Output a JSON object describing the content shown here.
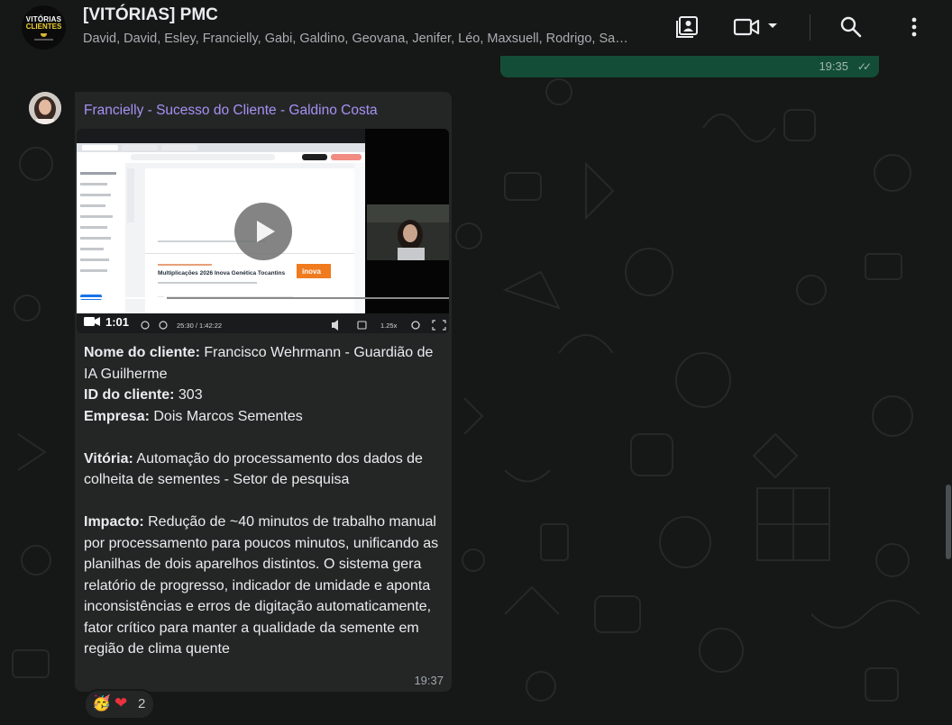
{
  "header": {
    "group_avatar_line1": "VITÓRIAS",
    "group_avatar_line2": "CLIENTES",
    "title": "[VITÓRIAS] PMC",
    "members": "David, David, Esley, Francielly, Gabi, Galdino, Geovana, Jenifer, Léo, Maxsuell, Rodrigo, Sandro, Você"
  },
  "icons": {
    "contact_card": "contact-card-icon",
    "video_call": "video-call-icon",
    "dropdown": "chevron-down-icon",
    "search": "search-icon",
    "menu": "more-vertical-icon"
  },
  "previous_message": {
    "time": "19:35",
    "status": "read"
  },
  "message": {
    "sender": "Francielly - Sucesso do Cliente - Galdino Costa",
    "video": {
      "duration": "1:01",
      "player_time": "25:30 / 1:42:22",
      "player_speed": "1.25x",
      "slide_title": "Multiplicações 2026 Inova Genética Tocantins",
      "slide_logo": "inova"
    },
    "fields": [
      {
        "label": "Nome do cliente:",
        "value": " Francisco Wehrmann - Guardião de IA Guilherme"
      },
      {
        "label": "ID do cliente:",
        "value": " 303"
      },
      {
        "label": "Empresa:",
        "value": " Dois Marcos Sementes"
      }
    ],
    "vitoria": {
      "label": "Vitória:",
      "value": " Automação do processamento dos dados de colheita de sementes - Setor de pesquisa"
    },
    "impacto": {
      "label": "Impacto:",
      "value": " Redução de ~40 minutos de trabalho manual por processamento para poucos minutos, unificando as planilhas de dois aparelhos distintos. O sistema gera relatório de progresso, indicador de umidade e aponta inconsistências e erros de digitação automaticamente,  fator crítico para manter a qualidade da semente em região de clima quente"
    },
    "time": "19:37"
  },
  "reactions": {
    "emoji1": "🥳",
    "emoji2": "❤",
    "count": "2"
  },
  "colors": {
    "background": "#161717",
    "incoming_bubble": "#242626",
    "outgoing_bubble": "#144d37",
    "sender_name": "#a791f5"
  }
}
